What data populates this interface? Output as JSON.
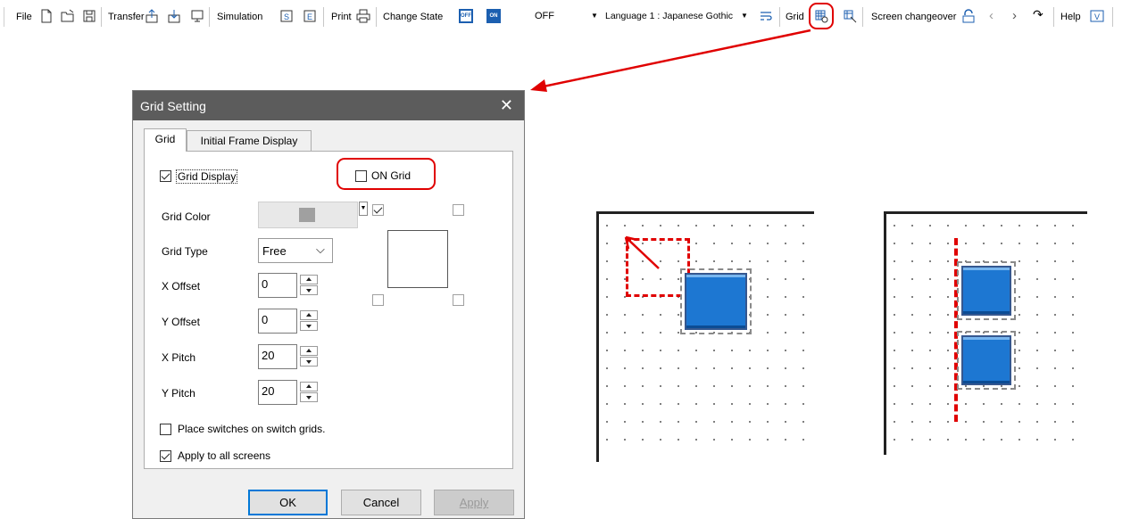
{
  "toolbar": {
    "file": "File",
    "transfer": "Transfer",
    "simulation": "Simulation",
    "print": "Print",
    "change_state": "Change State",
    "state_off_icon": "OFF",
    "state_on_icon": "ON",
    "state_value": "OFF",
    "language_value": "Language 1 : Japanese Gothic",
    "grid": "Grid",
    "screen_changeover": "Screen changeover",
    "help": "Help"
  },
  "dialog": {
    "title": "Grid Setting",
    "tabs": [
      "Grid",
      "Initial Frame Display"
    ],
    "grid_display_label": "Grid Display",
    "grid_display_checked": true,
    "on_grid_label": "ON Grid",
    "on_grid_checked": false,
    "grid_color_label": "Grid Color",
    "grid_color_value": "#a0a0a0",
    "grid_type_label": "Grid Type",
    "grid_type_value": "Free",
    "x_offset_label": "X Offset",
    "x_offset_value": "0",
    "y_offset_label": "Y Offset",
    "y_offset_value": "0",
    "x_pitch_label": "X Pitch",
    "x_pitch_value": "20",
    "y_pitch_label": "Y Pitch",
    "y_pitch_value": "20",
    "place_switches_label": "Place switches on switch grids.",
    "place_switches_checked": false,
    "apply_all_label": "Apply to all screens",
    "apply_all_checked": true,
    "ok": "OK",
    "cancel": "Cancel",
    "apply": "Apply"
  },
  "colors": {
    "highlight": "#e00000",
    "switch_blue": "#1d77d2",
    "title_bar": "#5c5c5c"
  }
}
